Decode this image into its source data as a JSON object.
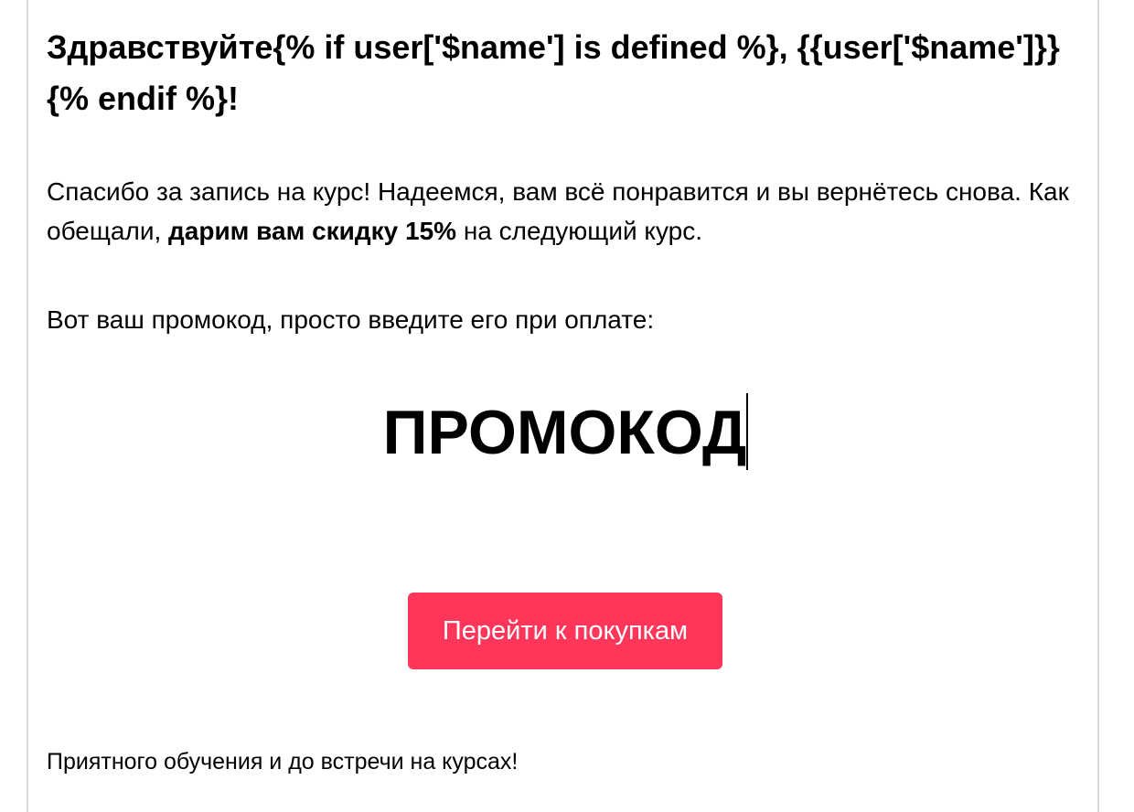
{
  "email": {
    "greeting": "Здравствуйте{% if user['$name'] is defined %}, {{user['$name']}}{% endif %}!",
    "thanks": {
      "before": "Спасибо за запись на курс! Надеемся, вам всё понравится и вы вернётесь снова. Как обещали, ",
      "bold": "дарим вам скидку 15%",
      "after": " на следующий курс."
    },
    "promo_intro": "Вот ваш промокод, просто введите его при оплате:",
    "promo_code": "ПРОМОКОД",
    "cta_label": "Перейти к покупкам",
    "closing": "Приятного обучения и до встречи на курсах!"
  },
  "colors": {
    "cta_background": "#ff3659",
    "cta_text": "#ffffff",
    "frame_border": "#d8d8d8",
    "text": "#000000"
  }
}
